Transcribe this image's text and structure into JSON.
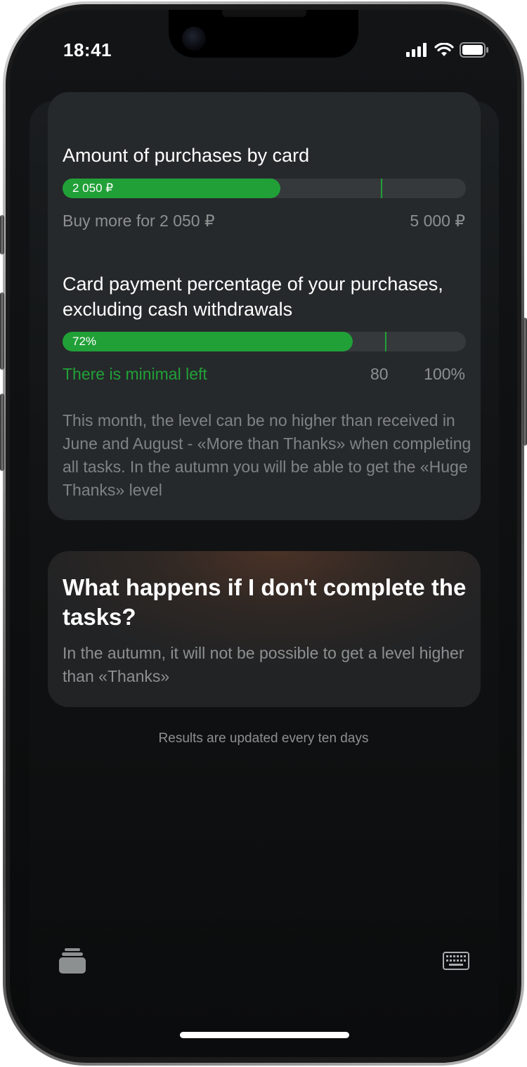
{
  "status_bar": {
    "time": "18:41"
  },
  "purchases": {
    "title": "Amount of purchases by card",
    "current_label": "2 050 ₽",
    "progress_fraction": 0.54,
    "marker_fraction": 0.79,
    "remaining_text": "Buy more for 2 050 ₽",
    "target": "5 000 ₽"
  },
  "card_payment": {
    "title": "Card payment percentage of your purchases, excluding cash withdrawals",
    "current_label": "72%",
    "progress_value": 72,
    "marker_value": 80,
    "status": "There is minimal left",
    "threshold": "80",
    "max": "100%"
  },
  "note": "This month, the level can be no higher than received in June and August - «More than Thanks» when completing all tasks. In the autumn you will be able to get the «Huge Thanks» level",
  "faq": {
    "title": "What happens if I don't complete the tasks?",
    "body": "In the autumn, it will not be possible to get a level higher than «Thanks»"
  },
  "footnote": "Results are updated every ten days",
  "toolbar": {
    "left_icon": "cards-stack-icon",
    "right_icon": "keyboard-icon"
  },
  "colors": {
    "accent": "#21a038",
    "card_bg": "#26292b",
    "text_secondary": "#8d9091"
  }
}
